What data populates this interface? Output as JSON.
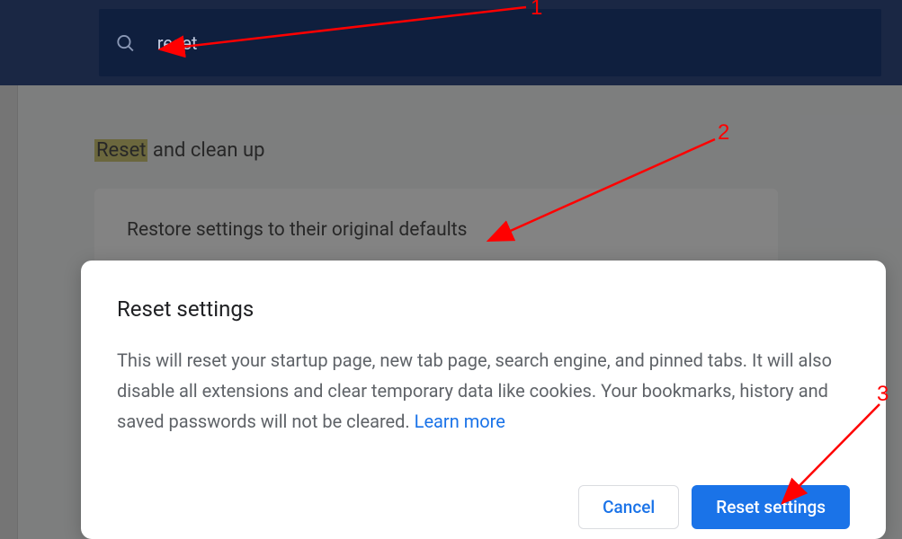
{
  "search": {
    "value": "reset"
  },
  "section": {
    "heading_highlight": "Reset",
    "heading_rest": " and clean up",
    "card_label": "Restore settings to their original defaults"
  },
  "dialog": {
    "title": "Reset settings",
    "body": "This will reset your startup page, new tab page, search engine, and pinned tabs. It will also disable all extensions and clear temporary data like cookies. Your bookmarks, history and saved passwords will not be cleared. ",
    "learn_more": "Learn more",
    "cancel_label": "Cancel",
    "confirm_label": "Reset settings"
  },
  "annotations": {
    "one": "1",
    "two": "2",
    "three": "3"
  }
}
